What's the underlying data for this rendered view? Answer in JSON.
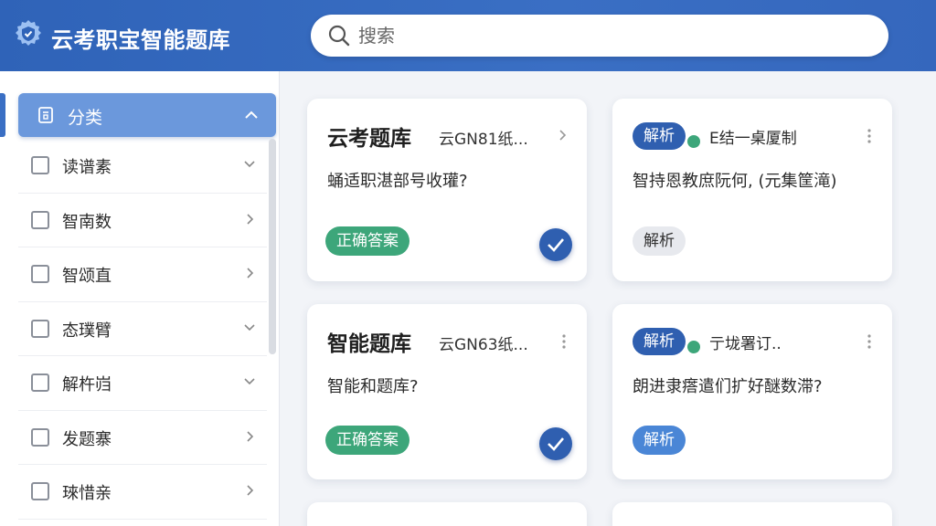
{
  "header": {
    "app_title": "云考职宝智能题库",
    "logo_icon": "gear-shield-icon",
    "search_placeholder": "搜索"
  },
  "sidebar": {
    "category_header": "分类",
    "items": [
      {
        "label": "读谱素",
        "chevron": "down"
      },
      {
        "label": "智南数",
        "chevron": "right"
      },
      {
        "label": "智颂直",
        "chevron": "right"
      },
      {
        "label": "态璞臂",
        "chevron": "down"
      },
      {
        "label": "解杵岿",
        "chevron": "down"
      },
      {
        "label": "发题寨",
        "chevron": "right"
      },
      {
        "label": "琜惜亲",
        "chevron": "right"
      }
    ]
  },
  "cards": [
    {
      "title": "云考题库",
      "subtitle": "云GN81纸...",
      "question": "蛹适职湛部号收瓘?",
      "badge": "正确答案"
    },
    {
      "badge": "解析",
      "subtitle": "E结一桌厦制",
      "question": "智持恩教庶阮何, (元集筐滝)",
      "button": "解析"
    },
    {
      "title": "智能题库",
      "subtitle": "云GN63纸...",
      "question": "智能和题库?",
      "badge": "正确答案"
    },
    {
      "badge": "解析",
      "subtitle": "亍垅署订..",
      "question": "朗进隶瘩遣们扩好醚数滞?",
      "button": "解析"
    }
  ],
  "colors": {
    "header_blue": "#3567bd",
    "category_blue": "#6b98dc",
    "correct_green": "#3da67a",
    "analysis_dark_blue": "#2f5fb0",
    "analysis_light_blue": "#4a86d6"
  }
}
